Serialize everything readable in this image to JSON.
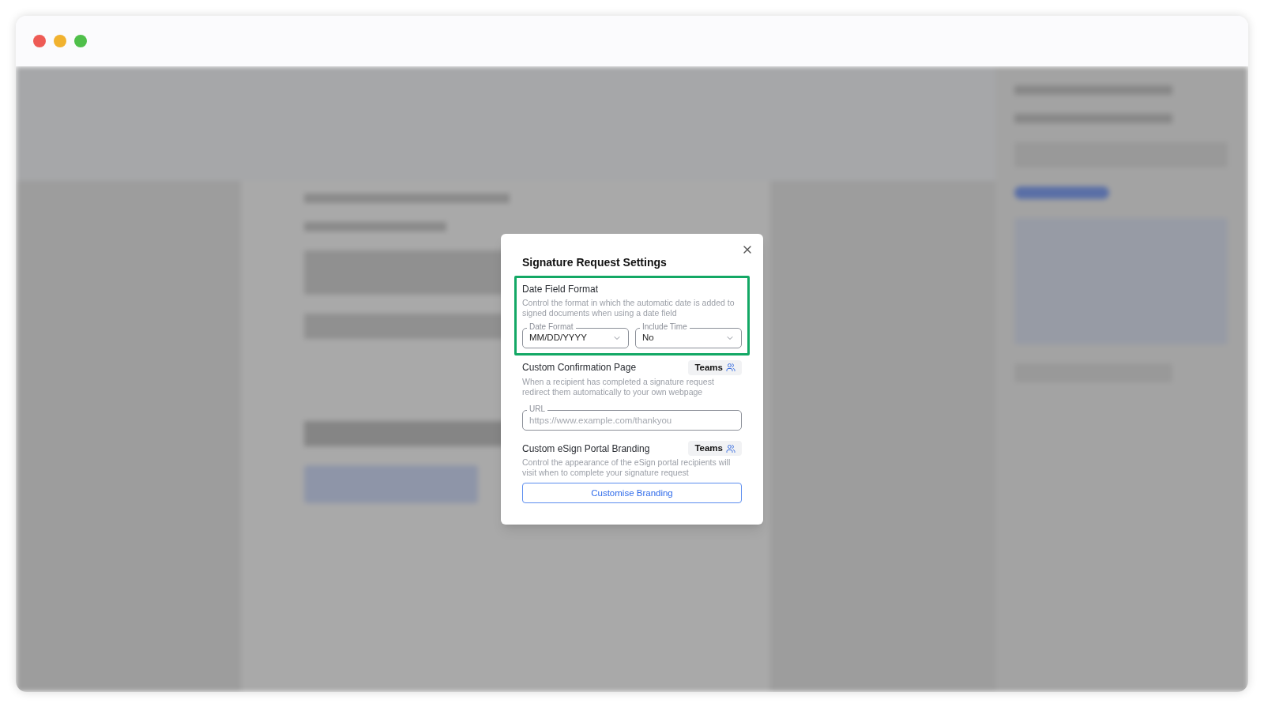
{
  "dialog": {
    "title": "Signature Request Settings",
    "sections": [
      {
        "kind": "selects",
        "title": "Date Field Format",
        "highlighted": true,
        "description": "Control the format in which the automatic date is added to signed documents when using a date field",
        "selects": [
          {
            "label": "Date Format",
            "value": "MM/DD/YYYY"
          },
          {
            "label": "Include Time",
            "value": "No"
          }
        ]
      },
      {
        "kind": "url",
        "title": "Custom Confirmation Page",
        "highlighted": false,
        "badge": "Teams",
        "description": "When a recipient has completed a signature request redirect them automatically to your own webpage",
        "field": {
          "label": "URL",
          "placeholder": "https://www.example.com/thankyou"
        }
      },
      {
        "kind": "button",
        "title": "Custom eSign Portal Branding",
        "highlighted": false,
        "badge": "Teams",
        "description": "Control the appearance of the eSign portal recipients will visit when to complete your signature request",
        "button": "Customise Branding"
      }
    ]
  }
}
